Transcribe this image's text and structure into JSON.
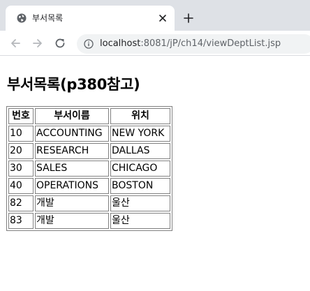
{
  "browser": {
    "tab_title": "부서목록",
    "url_host": "localhost",
    "url_rest": ":8081/jP/ch14/viewDeptList.jsp"
  },
  "page": {
    "title": "부서목록(p380참고)"
  },
  "table": {
    "headers": [
      "번호",
      "부서이름",
      "위치"
    ],
    "rows": [
      [
        "10",
        "ACCOUNTING",
        "NEW YORK"
      ],
      [
        "20",
        "RESEARCH",
        "DALLAS"
      ],
      [
        "30",
        "SALES",
        "CHICAGO"
      ],
      [
        "40",
        "OPERATIONS",
        "BOSTON"
      ],
      [
        "82",
        "개발",
        "울산"
      ],
      [
        "83",
        "개발",
        "울산"
      ]
    ]
  },
  "icons": {
    "favicon": "globe-icon",
    "close": "close-icon",
    "new_tab": "plus-icon",
    "back": "back-arrow-icon",
    "forward": "forward-arrow-icon",
    "reload": "reload-icon",
    "site_info": "info-icon"
  }
}
